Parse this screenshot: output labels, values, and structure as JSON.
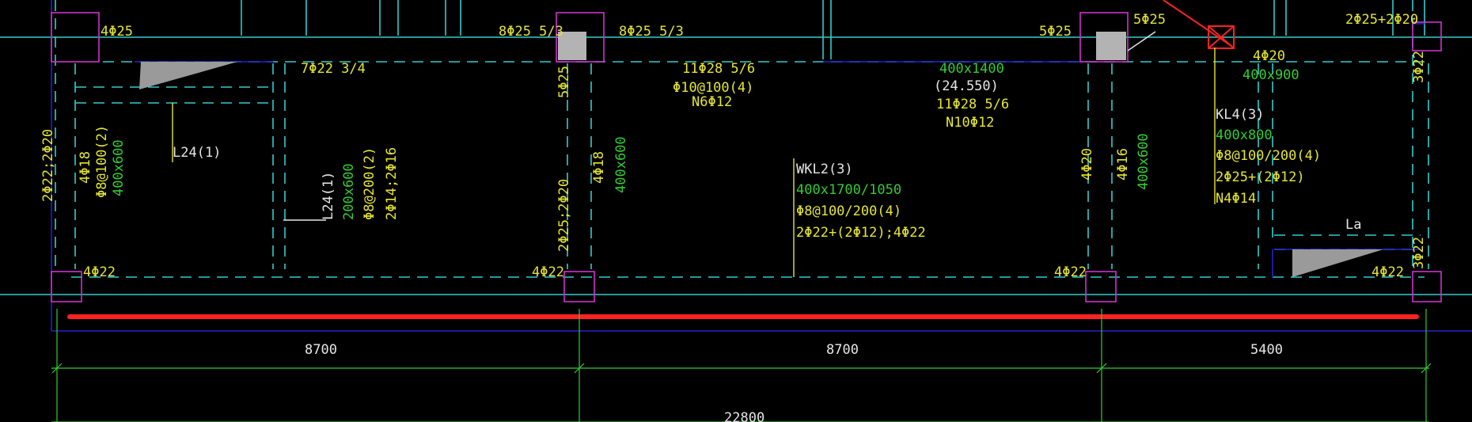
{
  "colors": {
    "background": "#000000",
    "grid_line": "#33cccc",
    "dimension": "#33cc33",
    "annotation": "#e6e633",
    "highlight_beam": "#ff2222",
    "column_outline": "#cc33cc",
    "outline_blue": "#2222cc"
  },
  "labels": {
    "l_4p25": "4Φ25",
    "l_8p25a": "8Φ25 5/3",
    "l_8p25b": "8Φ25 5/3",
    "l_5p25_mid": "5Φ25",
    "l_5p25_r": "5Φ25",
    "l_2p25_2p20_top": "2Φ25+2Φ20",
    "l_7p22": "7Φ22 3/4",
    "l_11p28a": "11Φ28 5/6",
    "l_p10": "Φ10@100(4)",
    "l_n6": "N6Φ12",
    "l_400x1400": "400x1400",
    "l_24550": "(24.550)",
    "l_11p28b": "11Φ28 5/6",
    "l_n10": "N10Φ12",
    "l_4p20_r": "4Φ20",
    "l_400x900": "400x900",
    "l_3p22_top": "3Φ22",
    "l_5p25_v": "5Φ25",
    "l_kl4": "KL4(3)",
    "l_400x800": "400x800",
    "l_p8_200_4": "Φ8@100/200(4)",
    "l_2p25_2p12": "2Φ25+(2Φ12)",
    "l_n4": "N4Φ14",
    "l_l24a": "L24(1)",
    "l_2p22_2p20": "2Φ22;2Φ20",
    "l_4p18a": "4Φ18",
    "l_p8_100_2": "Φ8@100(2)",
    "l_400x600a": "400x600",
    "l_l24b": "L24(1)",
    "l_200x600": "200x600",
    "l_p8_200_2": "Φ8@200(2)",
    "l_2p14_2p16": "2Φ14;2Φ16",
    "l_2p25_2p20_v": "2Φ25;2Φ20",
    "l_4p18b": "4Φ18",
    "l_400x600b": "400x600",
    "l_wkl2": "WKL2(3)",
    "l_400x1700": "400x1700/1050",
    "l_p8_wkl": "Φ8@100/200(4)",
    "l_2p22_wkl": "2Φ22+(2Φ12);4Φ22",
    "l_4p20_v": "4Φ20",
    "l_4p16": "4Φ16",
    "l_400x600c": "400x600",
    "l_la": "La",
    "l_3p22_bot": "3Φ22",
    "l_4p22a": "4Φ22",
    "l_4p22b": "4Φ22",
    "l_4p22c": "4Φ22",
    "l_4p22d": "4Φ22"
  },
  "dimensions": {
    "span1": "8700",
    "span2": "8700",
    "span3": "5400",
    "total": "22800"
  }
}
